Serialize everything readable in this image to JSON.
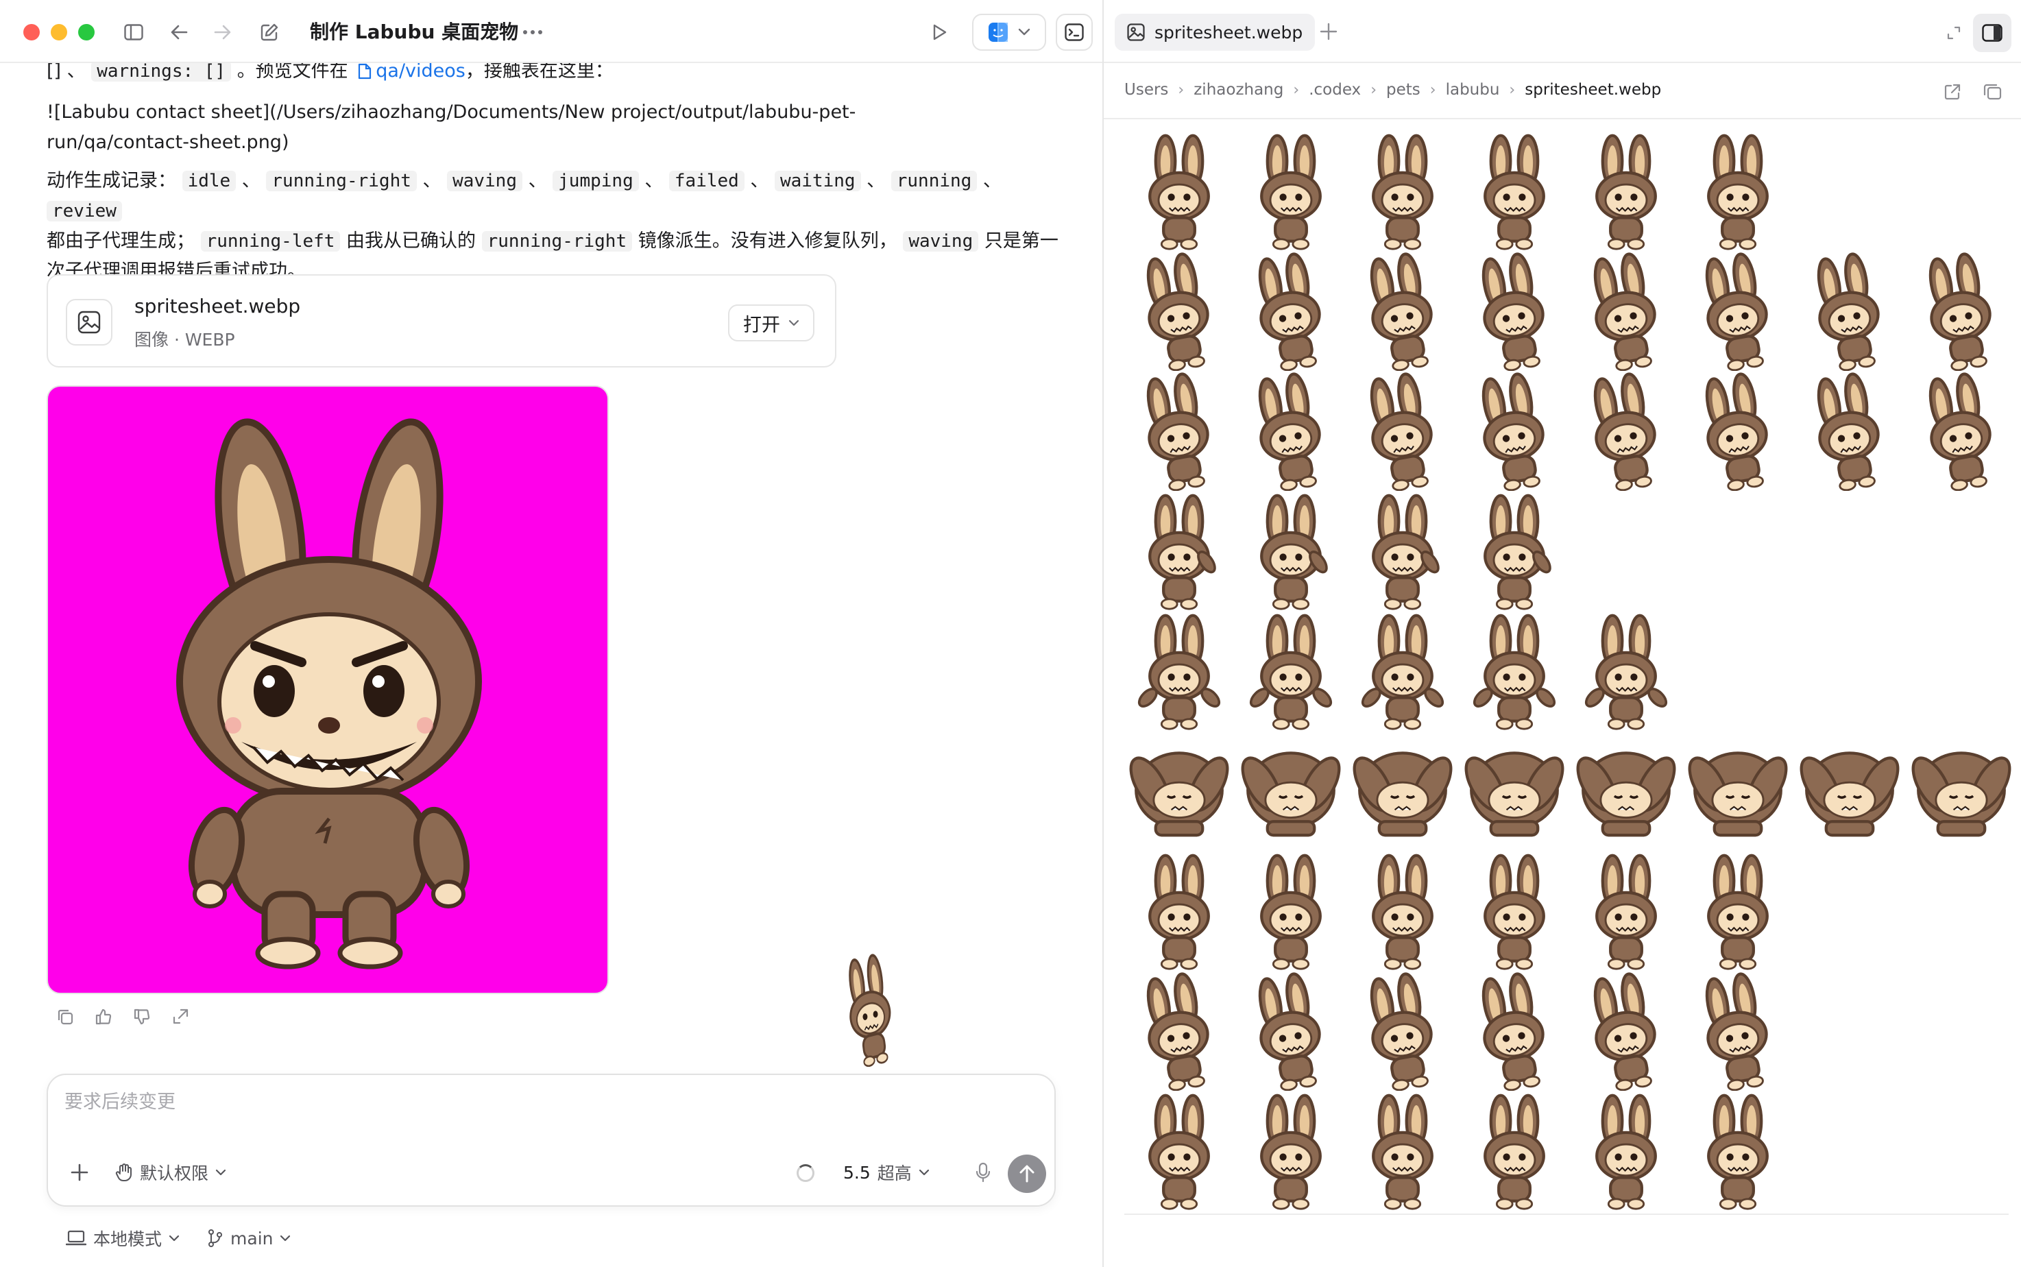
{
  "window": {
    "title": "制作 Labubu 桌面宠物",
    "colors": {
      "close": "#ff5f57",
      "minimize": "#febc2e",
      "zoom": "#28c840"
    }
  },
  "chat": {
    "line1_prefix": "[] 、",
    "line1_code": "warnings: []",
    "line1_mid": "。预览文件在",
    "line1_link": "qa/videos",
    "line1_suffix": "，接触表在这里：",
    "contact_sheet_line": "![Labubu contact sheet](/Users/zihaozhang/Documents/New project/output/labubu-pet-run/qa/contact-sheet.png)",
    "anim_lead": "动作生成记录：",
    "anim_names": [
      "idle",
      "running-right",
      "waving",
      "jumping",
      "failed",
      "waiting",
      "running",
      "review"
    ],
    "anim_sep": "、",
    "anim_tail_1": "都由子代理生成；",
    "anim_code_left": "running-left",
    "anim_tail_2": "由我从已确认的",
    "anim_code_right": "running-right",
    "anim_tail_3": "镜像派生。没有进入修复队列，",
    "anim_code_waving": "waving",
    "anim_tail_4": "只是第一次子代理调用报错后重试成功。"
  },
  "file_card": {
    "name": "spritesheet.webp",
    "meta": "图像 · WEBP",
    "open_label": "打开",
    "icon": "image-icon"
  },
  "preview": {
    "background": "#ff00ea"
  },
  "composer": {
    "placeholder": "要求后续变更",
    "permission_label": "默认权限",
    "model_version": "5.5",
    "model_effort": "超高"
  },
  "footer": {
    "mode_label": "本地模式",
    "branch_label": "main"
  },
  "right_pane": {
    "tab_label": "spritesheet.webp",
    "breadcrumb": [
      "Users",
      "zihaozhang",
      ".codex",
      "pets",
      "labubu",
      "spritesheet.webp"
    ],
    "sprite_rows": [
      {
        "pose": "idle",
        "count": 6
      },
      {
        "pose": "running-right",
        "count": 8
      },
      {
        "pose": "running-left",
        "count": 8
      },
      {
        "pose": "waving",
        "count": 4
      },
      {
        "pose": "jumping",
        "count": 5
      },
      {
        "pose": "failed",
        "count": 8
      },
      {
        "pose": "waiting",
        "count": 6
      },
      {
        "pose": "running",
        "count": 6
      },
      {
        "pose": "review",
        "count": 6
      }
    ]
  }
}
